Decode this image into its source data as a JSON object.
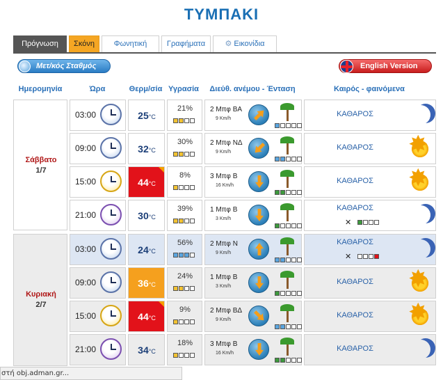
{
  "page": {
    "title": "ΤΥΜΠΑΚΙ"
  },
  "tabs": [
    {
      "label": "Πρόγνωση"
    },
    {
      "label": "Σκόνη"
    },
    {
      "label": "Φωνητική"
    },
    {
      "label": "Γραφήματα"
    },
    {
      "label": "Εικονίδια"
    }
  ],
  "buttons": {
    "station": "Μετ/κός Σταθμός",
    "english": "English Version"
  },
  "headers": {
    "date": "Ημερομηνία",
    "time": "Ώρα",
    "temp": "Θερμ/σία",
    "humidity": "Υγρασία",
    "wind": "Διεύθ. ανέμου - Ένταση",
    "weather": "Καιρός - φαινόμενα"
  },
  "days": [
    {
      "name": "Σάββατο",
      "date": "1/7"
    },
    {
      "name": "Κυριακή",
      "date": "2/7"
    }
  ],
  "rows": [
    {
      "time": "03:00",
      "temp": "25",
      "unit": "°C",
      "humidity": "21%",
      "wind": "2 Μπφ ΒΑ",
      "speed": "9 Km/h",
      "weather": "ΚΑΘΑΡΟΣ"
    },
    {
      "time": "09:00",
      "temp": "32",
      "unit": "°C",
      "humidity": "30%",
      "wind": "2 Μπφ ΝΔ",
      "speed": "9 Km/h",
      "weather": "ΚΑΘΑΡΟΣ"
    },
    {
      "time": "15:00",
      "temp": "44",
      "unit": "°C",
      "humidity": "8%",
      "wind": "3 Μπφ Β",
      "speed": "16 Km/h",
      "weather": "ΚΑΘΑΡΟΣ"
    },
    {
      "time": "21:00",
      "temp": "30",
      "unit": "°C",
      "humidity": "39%",
      "wind": "1 Μπφ Β",
      "speed": "3 Km/h",
      "weather": "ΚΑΘΑΡΟΣ"
    },
    {
      "time": "03:00",
      "temp": "24",
      "unit": "°C",
      "humidity": "56%",
      "wind": "2 Μπφ Ν",
      "speed": "9 Km/h",
      "weather": "ΚΑΘΑΡΟΣ"
    },
    {
      "time": "09:00",
      "temp": "36",
      "unit": "°C",
      "humidity": "24%",
      "wind": "1 Μπφ Β",
      "speed": "3 Km/h",
      "weather": "ΚΑΘΑΡΟΣ"
    },
    {
      "time": "15:00",
      "temp": "44",
      "unit": "°C",
      "humidity": "9%",
      "wind": "2 Μπφ ΒΔ",
      "speed": "9 Km/h",
      "weather": "ΚΑΘΑΡΟΣ"
    },
    {
      "time": "21:00",
      "temp": "34",
      "unit": "°C",
      "humidity": "18%",
      "wind": "3 Μπφ Β",
      "speed": "16 Km/h",
      "weather": "ΚΑΘΑΡΟΣ"
    }
  ],
  "statusbar": {
    "text": "στή obj.adman.gr..."
  }
}
